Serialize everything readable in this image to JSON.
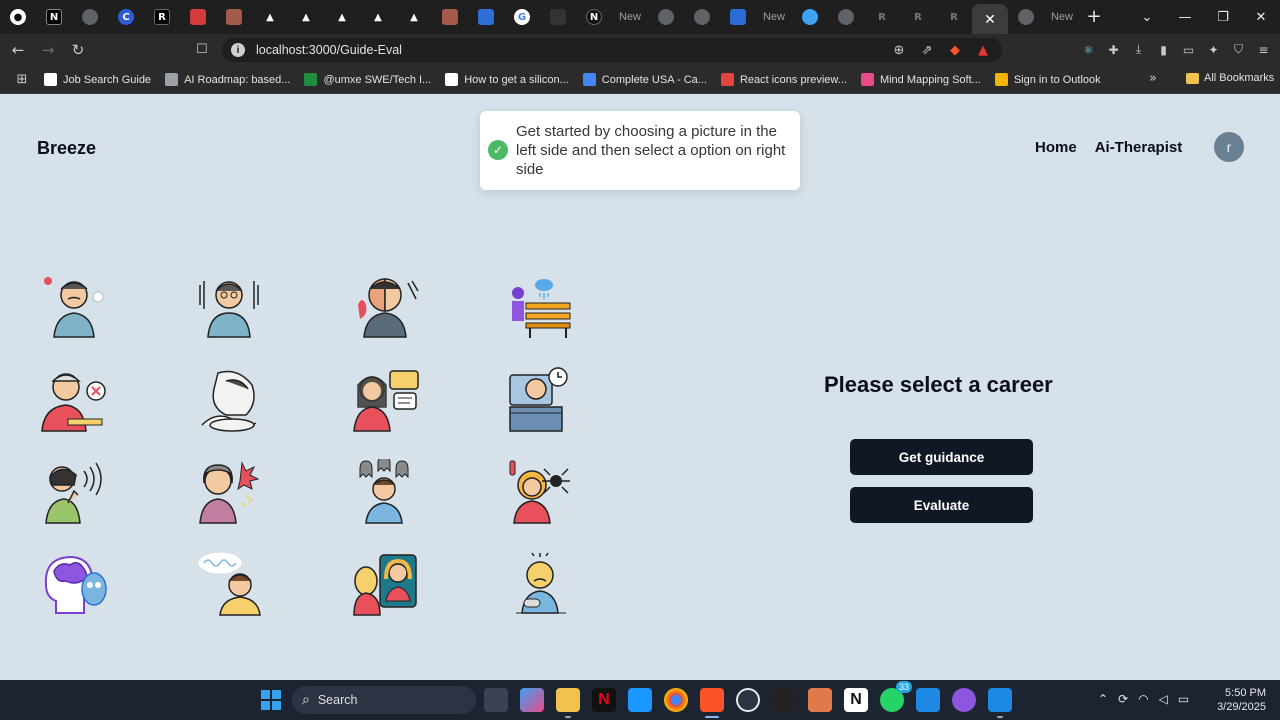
{
  "browser": {
    "address": "localhost:3000/Guide-Eval",
    "tab_labels": [
      "New",
      "New",
      "New"
    ],
    "bookmarks": [
      {
        "label": "Job Search Guide",
        "color": "#ffffff"
      },
      {
        "label": "AI Roadmap: based...",
        "color": "#9aa0a6"
      },
      {
        "label": "@umxe SWE/Tech I...",
        "color": "#1e8e3e"
      },
      {
        "label": "How to get a silicon...",
        "color": "#ffffff"
      },
      {
        "label": "Complete USA - Ca...",
        "color": "#4285f4"
      },
      {
        "label": "React icons preview...",
        "color": "#e2453c"
      },
      {
        "label": "Mind Mapping Soft...",
        "color": "#e84a8a"
      },
      {
        "label": "Sign in to Outlook",
        "color": "#f4b400"
      }
    ],
    "all_bookmarks": "All Bookmarks"
  },
  "header": {
    "brand": "Breeze",
    "nav": [
      {
        "label": "Home"
      },
      {
        "label": "Ai-Therapist"
      }
    ],
    "avatar_letter": "r"
  },
  "toast": {
    "message": "Get started by choosing a picture in the left side and then select a option on right side"
  },
  "gallery": {
    "items": [
      "angry-person-icon",
      "anxious-person-icon",
      "split-personality-icon",
      "lonely-bench-icon",
      "sad-meal-icon",
      "hooded-sitting-icon",
      "stressed-talk-icon",
      "overtime-desk-icon",
      "loud-noise-icon",
      "crying-woman-icon",
      "ghost-fear-icon",
      "spider-phobia-icon",
      "brain-mind-icon",
      "overthinking-icon",
      "phone-mirror-icon",
      "sad-sweat-icon"
    ]
  },
  "panel": {
    "title": "Please select a career",
    "guidance_label": "Get guidance",
    "evaluate_label": "Evaluate"
  },
  "taskbar": {
    "search_label": "Search",
    "whatsapp_badge": "33",
    "time": "5:50 PM",
    "date": "3/29/2025"
  }
}
